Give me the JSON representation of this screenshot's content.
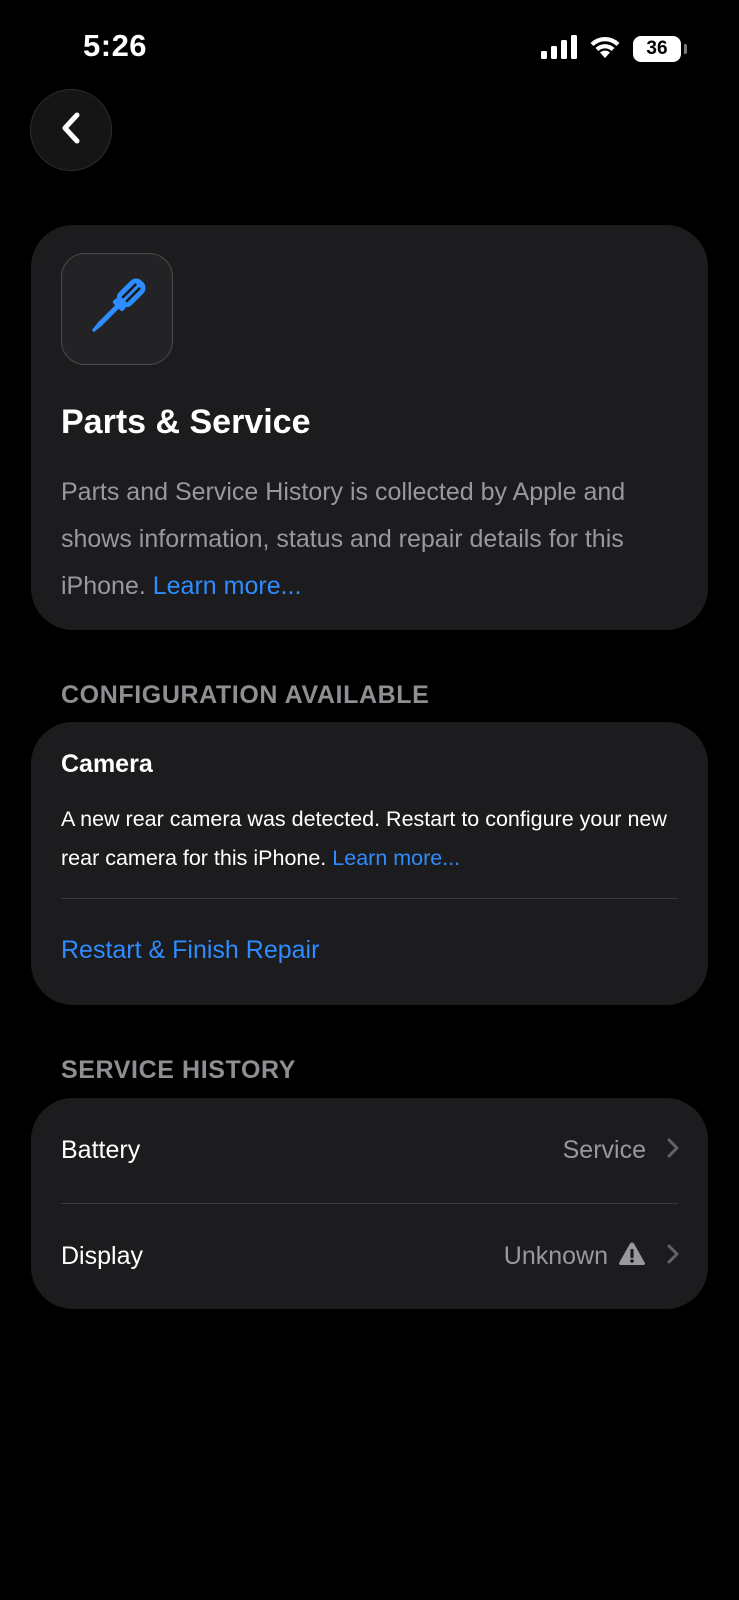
{
  "status_bar": {
    "time": "5:26",
    "battery_level": "36"
  },
  "header": {
    "back_icon": "chevron-left-icon"
  },
  "intro_card": {
    "icon": "screwdriver-icon",
    "title": "Parts & Service",
    "description": "Parts and Service History is collected by Apple and shows information, status and repair details for this iPhone.",
    "learn_more": "Learn more..."
  },
  "configuration": {
    "section_title": "CONFIGURATION AVAILABLE",
    "item_title": "Camera",
    "description": "A new rear camera was detected. Restart to configure your new rear camera for this iPhone.",
    "learn_more": "Learn more...",
    "action_label": "Restart & Finish Repair"
  },
  "service_history": {
    "section_title": "SERVICE HISTORY",
    "items": [
      {
        "label": "Battery",
        "value": "Service"
      },
      {
        "label": "Display",
        "value": "Unknown",
        "status_icon": "warning-triangle-icon"
      }
    ]
  },
  "colors": {
    "background": "#000000",
    "card": "#1c1c1e",
    "accent": "#2d8cff",
    "secondary_text": "#98989e"
  }
}
